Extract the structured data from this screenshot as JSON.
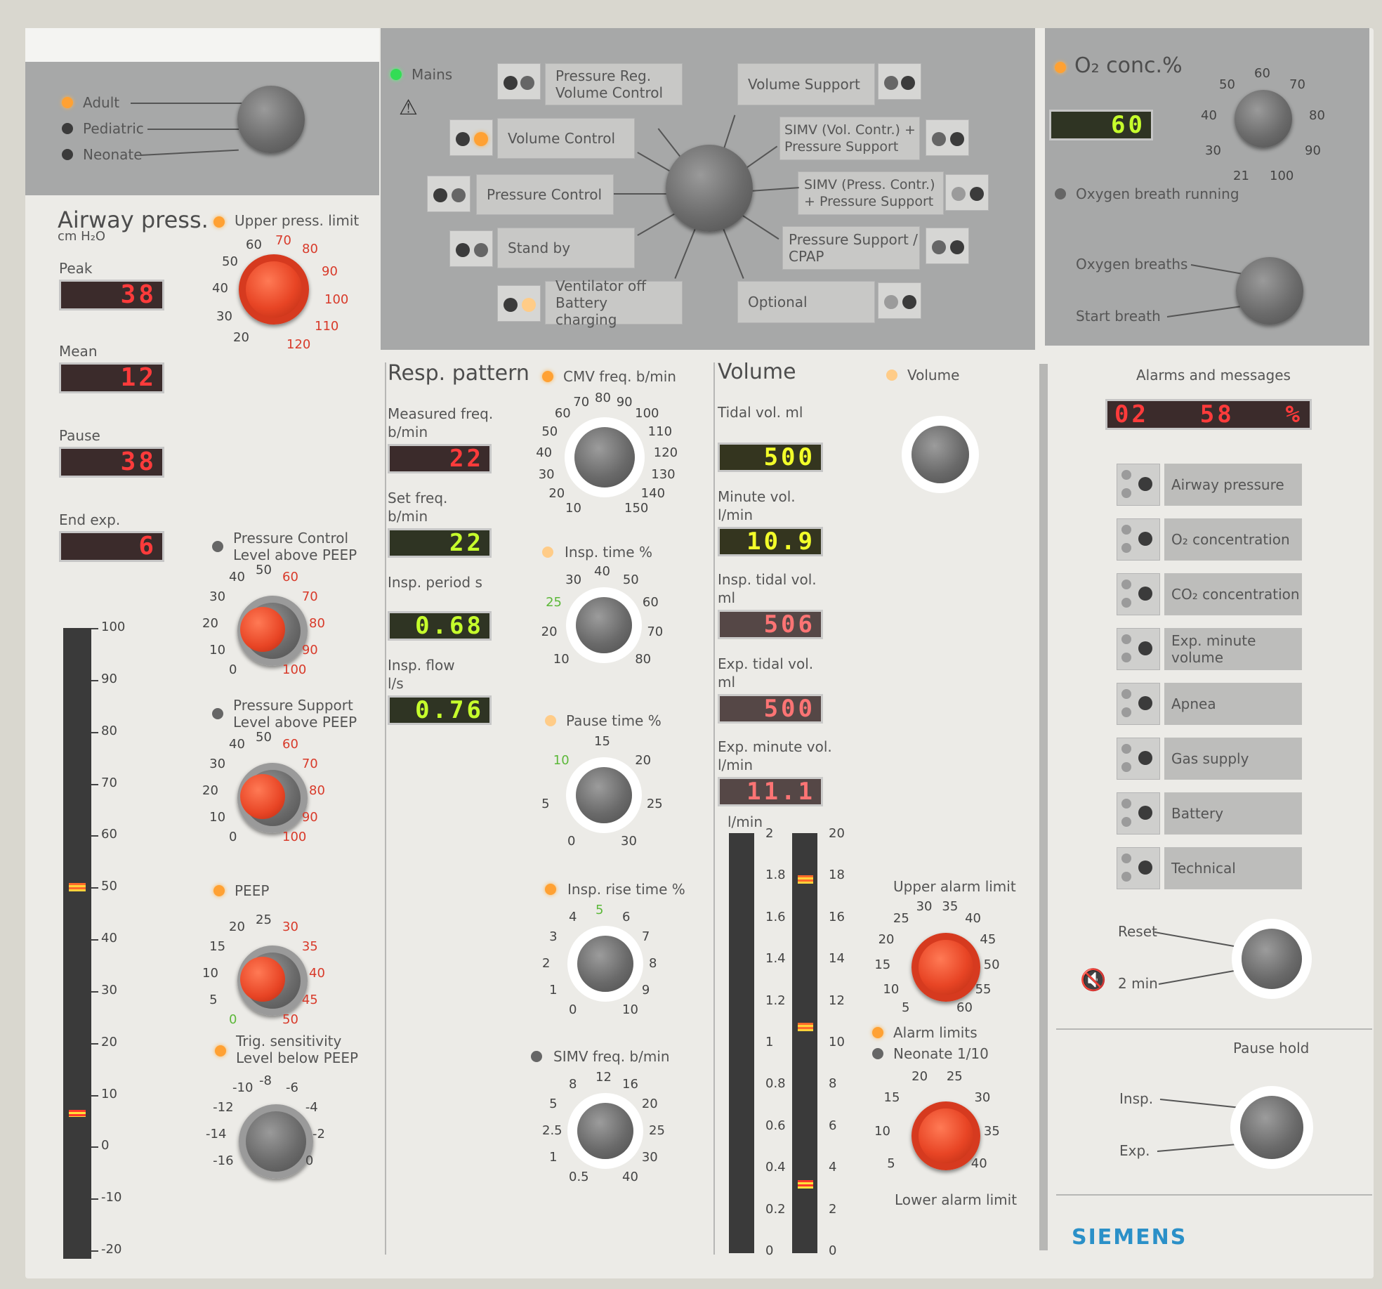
{
  "patient": {
    "adult": "Adult",
    "pediatric": "Pediatric",
    "neonate": "Neonate"
  },
  "mode": {
    "mains": "Mains",
    "pressure_reg_volume_control": "Pressure Reg. Volume Control",
    "volume_control": "Volume Control",
    "pressure_control": "Pressure Control",
    "stand_by": "Stand by",
    "ventilator_off": "Ventilator off Battery charging",
    "volume_support": "Volume Support",
    "simv_vol": "SIMV (Vol. Contr.) + Pressure Support",
    "simv_press": "SIMV (Press. Contr.) + Pressure Support",
    "pressure_support_cpap": "Pressure Support / CPAP",
    "optional": "Optional"
  },
  "o2": {
    "title": "O₂ conc.%",
    "value": "60",
    "scale": [
      "21",
      "30",
      "40",
      "50",
      "60",
      "70",
      "80",
      "90",
      "100"
    ],
    "oxygen_breath_running": "Oxygen breath running",
    "oxygen_breaths": "Oxygen breaths",
    "start_breath": "Start breath"
  },
  "airway": {
    "title": "Airway press.",
    "unit": "cm H₂O",
    "upper_limit": "Upper press. limit",
    "peak_label": "Peak",
    "peak": "38",
    "mean_label": "Mean",
    "mean": "12",
    "pause_label": "Pause",
    "pause": "38",
    "endexp_label": "End exp.",
    "endexp": "6",
    "bar_scale": [
      "100",
      "90",
      "80",
      "70",
      "60",
      "50",
      "40",
      "30",
      "20",
      "10",
      "0",
      "-10",
      "-20"
    ],
    "bar_value": 50,
    "upper_scale": [
      "20",
      "30",
      "40",
      "50",
      "60",
      "70",
      "80",
      "90",
      "100",
      "110",
      "120"
    ],
    "pc_level": "Pressure Control Level above PEEP",
    "ps_level": "Pressure Support Level above PEEP",
    "level_scale": [
      "0",
      "10",
      "20",
      "30",
      "40",
      "50",
      "60",
      "70",
      "80",
      "90",
      "100"
    ],
    "peep": "PEEP",
    "peep_scale": [
      "0",
      "5",
      "10",
      "15",
      "20",
      "25",
      "30",
      "35",
      "40",
      "45",
      "50"
    ],
    "trig": "Trig. sensitivity Level below PEEP",
    "trig_scale": [
      "-16",
      "-14",
      "-12",
      "-10",
      "-8",
      "-6",
      "-4",
      "-2",
      "0"
    ]
  },
  "resp": {
    "title": "Resp. pattern",
    "cmv": "CMV freq. b/min",
    "cmv_scale": [
      "10",
      "20",
      "30",
      "40",
      "50",
      "60",
      "70",
      "80",
      "90",
      "100",
      "110",
      "120",
      "130",
      "140",
      "150"
    ],
    "measured_freq": "Measured freq. b/min",
    "measured_value": "22",
    "set_freq": "Set freq. b/min",
    "set_value": "22",
    "insp_period": "Insp. period s",
    "insp_period_value": "0.68",
    "insp_flow": "Insp. flow l/s",
    "insp_flow_value": "0.76",
    "insp_time": "Insp. time %",
    "insp_time_scale": [
      "10",
      "20",
      "25",
      "30",
      "40",
      "50",
      "60",
      "70",
      "80"
    ],
    "pause_time": "Pause time %",
    "pause_time_scale": [
      "0",
      "5",
      "10",
      "15",
      "20",
      "25",
      "30"
    ],
    "rise_time": "Insp. rise time %",
    "rise_scale": [
      "0",
      "1",
      "2",
      "3",
      "4",
      "5",
      "6",
      "7",
      "8",
      "9",
      "10"
    ],
    "simv": "SIMV freq. b/min",
    "simv_scale": [
      "0.5",
      "1",
      "2.5",
      "5",
      "8",
      "12",
      "16",
      "20",
      "25",
      "30",
      "40"
    ]
  },
  "volume": {
    "title": "Volume",
    "volume_knob": "Volume",
    "tidal": "Tidal vol. ml",
    "tidal_value": "500",
    "minute": "Minute vol. l/min",
    "minute_value": "10.9",
    "insp_tidal": "Insp. tidal vol. ml",
    "insp_tidal_value": "506",
    "exp_tidal": "Exp. tidal vol. ml",
    "exp_tidal_value": "500",
    "exp_minute": "Exp. minute vol. l/min",
    "exp_minute_value": "11.1",
    "flow_unit": "l/min",
    "flow_scale": [
      "2",
      "1.8",
      "1.6",
      "1.4",
      "1.2",
      "1",
      "0.8",
      "0.6",
      "0.4",
      "0.2",
      "0"
    ],
    "minute_scale": [
      "20",
      "18",
      "16",
      "14",
      "12",
      "10",
      "8",
      "6",
      "4",
      "2",
      "0"
    ],
    "upper_alarm": "Upper alarm limit",
    "upper_alarm_scale": [
      "5",
      "10",
      "15",
      "20",
      "25",
      "30",
      "35",
      "40",
      "45",
      "50",
      "55",
      "60"
    ],
    "alarm_limits": "Alarm limits",
    "neonate": "Neonate 1/10",
    "lower_alarm_scale": [
      "5",
      "10",
      "15",
      "20",
      "25",
      "30",
      "35",
      "40"
    ],
    "lower_alarm": "Lower alarm limit"
  },
  "alarms": {
    "title": "Alarms and messages",
    "display": [
      "02",
      "58",
      "%"
    ],
    "items": [
      "Airway pressure",
      "O₂ concentration",
      "CO₂ concentration",
      "Exp. minute volume",
      "Apnea",
      "Gas supply",
      "Battery",
      "Technical"
    ],
    "reset": "Reset",
    "two_min": "2 min",
    "pause_hold": "Pause hold",
    "insp": "Insp.",
    "exp": "Exp.",
    "brand": "SIEMENS"
  },
  "colors": {
    "accent_red": "#e84525",
    "led_orange": "#ffa133",
    "lcd_red": "#ff3b3b",
    "lcd_green": "#c6ff2c",
    "brand": "#2b90c8"
  }
}
